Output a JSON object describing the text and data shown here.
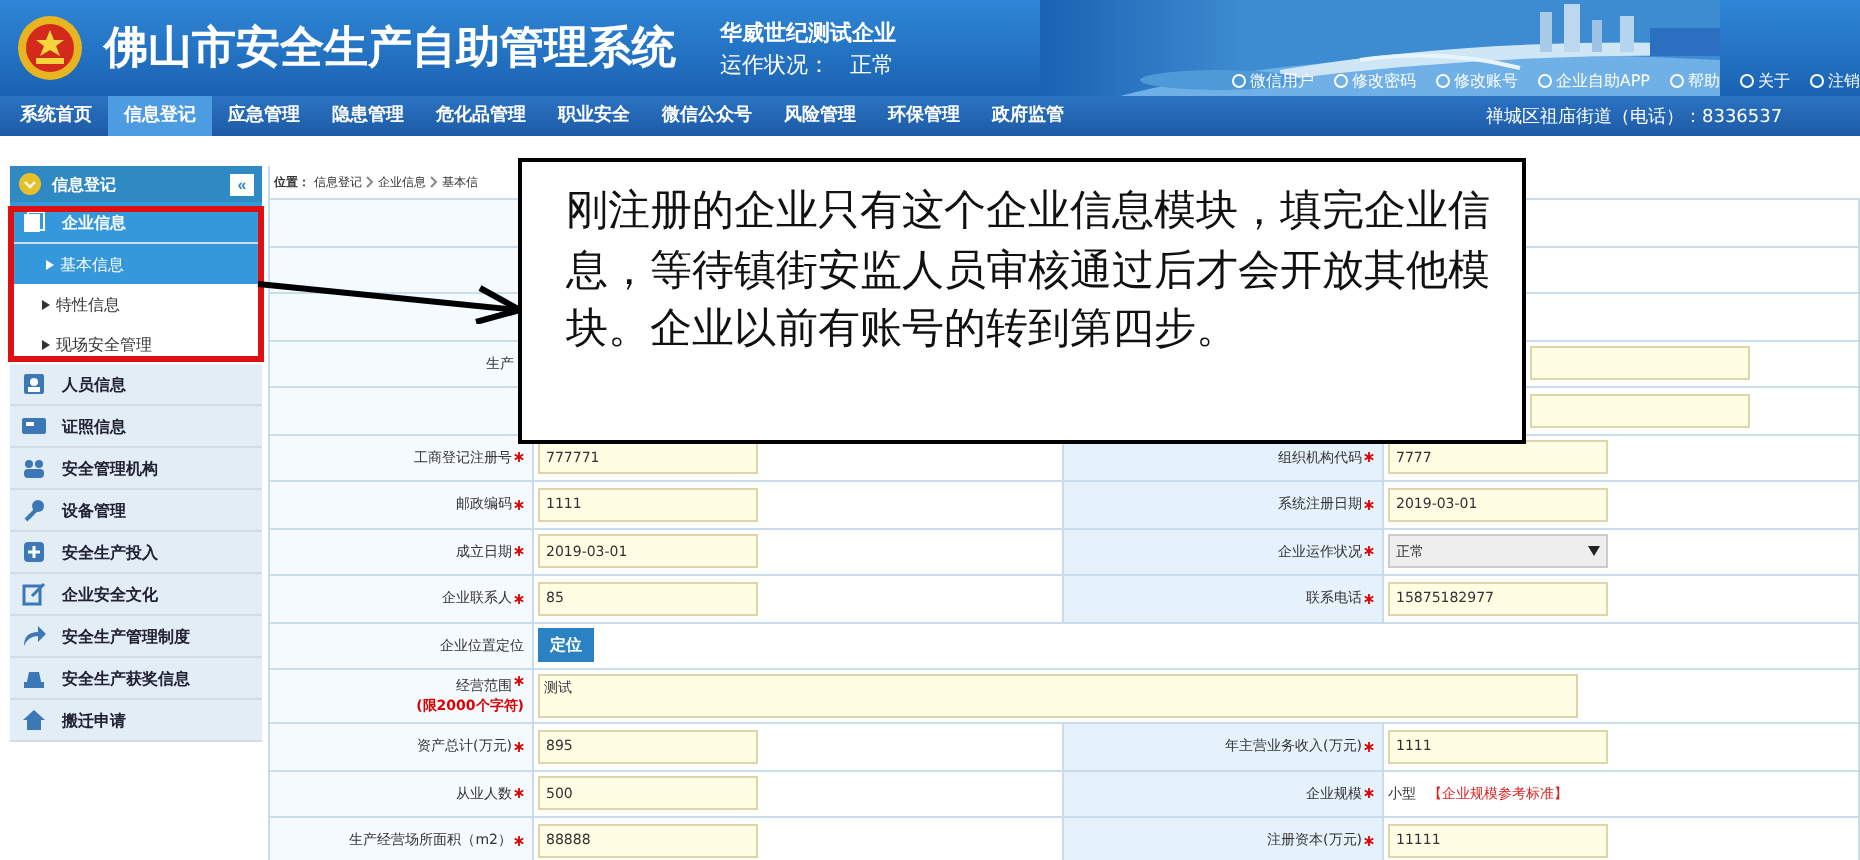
{
  "header": {
    "title": "佛山市安全生产自助管理系统",
    "company": "华威世纪测试企业",
    "status_label": "运作状况：",
    "status_value": "正常",
    "links": [
      "微信用户",
      "修改密码",
      "修改账号",
      "企业自助APP",
      "帮助",
      "关于",
      "注销"
    ]
  },
  "nav": {
    "items": [
      {
        "label": "系统首页",
        "selected": false
      },
      {
        "label": "信息登记",
        "selected": true
      },
      {
        "label": "应急管理",
        "selected": false
      },
      {
        "label": "隐患管理",
        "selected": false
      },
      {
        "label": "危化品管理",
        "selected": false
      },
      {
        "label": "职业安全",
        "selected": false
      },
      {
        "label": "微信公众号",
        "selected": false
      },
      {
        "label": "风险管理",
        "selected": false
      },
      {
        "label": "环保管理",
        "selected": false
      },
      {
        "label": "政府监管",
        "selected": false
      }
    ],
    "contact": "禅城区祖庙街道（电话）：8336537"
  },
  "sidebar": {
    "title": "信息登记",
    "collapse": "«",
    "items": [
      {
        "label": "企业信息",
        "expanded": true,
        "children": [
          {
            "label": "基本信息",
            "selected": true
          },
          {
            "label": "特性信息",
            "selected": false
          },
          {
            "label": "现场安全管理",
            "selected": false
          }
        ]
      },
      {
        "label": "人员信息",
        "expanded": false
      },
      {
        "label": "证照信息",
        "expanded": false
      },
      {
        "label": "安全管理机构",
        "expanded": false
      },
      {
        "label": "设备管理",
        "expanded": false
      },
      {
        "label": "安全生产投入",
        "expanded": false
      },
      {
        "label": "企业安全文化",
        "expanded": false
      },
      {
        "label": "安全生产管理制度",
        "expanded": false
      },
      {
        "label": "安全生产获奖信息",
        "expanded": false
      },
      {
        "label": "搬迁申请",
        "expanded": false
      }
    ]
  },
  "breadcrumb": {
    "label": "位置：",
    "path": [
      "信息登记",
      "企业信息",
      "基本信"
    ]
  },
  "form": {
    "rows": [
      {
        "kind": "hidden"
      },
      {
        "kind": "hidden"
      },
      {
        "kind": "hidden"
      },
      {
        "kind": "hidden",
        "label": "生产",
        "field": true
      },
      {
        "kind": "hidden",
        "field": true
      },
      {
        "kind": "pair",
        "left": {
          "label": "工商登记注册号",
          "required": true,
          "value": "777771"
        },
        "right": {
          "label": "组织机构代码",
          "required": true,
          "value": "7777"
        }
      },
      {
        "kind": "pair",
        "left": {
          "label": "邮政编码",
          "required": true,
          "value": "1111"
        },
        "right": {
          "label": "系统注册日期",
          "required": true,
          "value": "2019-03-01"
        }
      },
      {
        "kind": "pair",
        "left": {
          "label": "成立日期",
          "required": true,
          "value": "2019-03-01"
        },
        "right": {
          "label": "企业运作状况",
          "required": true,
          "value": "正常",
          "kind": "select"
        }
      },
      {
        "kind": "pair",
        "left": {
          "label": "企业联系人",
          "required": true,
          "value": "85"
        },
        "right": {
          "label": "联系电话",
          "required": true,
          "value": "15875182977"
        }
      },
      {
        "kind": "button",
        "label": "企业位置定位",
        "button": "定位"
      },
      {
        "kind": "textarea",
        "label": "经营范围",
        "required": true,
        "note": "(限2000个字符)",
        "value": "测试"
      },
      {
        "kind": "pair",
        "left": {
          "label": "资产总计(万元)",
          "required": true,
          "value": "895"
        },
        "right": {
          "label": "年主营业务收入(万元)",
          "required": true,
          "value": "1111"
        }
      },
      {
        "kind": "pair",
        "left": {
          "label": "从业人数",
          "required": true,
          "value": "500"
        },
        "right": {
          "label": "企业规模",
          "required": true,
          "text": "小型",
          "link": "【企业规模参考标准】"
        }
      },
      {
        "kind": "pair",
        "left": {
          "label": "生产经营场所面积（m2）",
          "required": true,
          "value": "88888"
        },
        "right": {
          "label": "注册资本(万元)",
          "required": true,
          "value": "11111"
        }
      }
    ]
  },
  "callout": {
    "text": "刚注册的企业只有这个企业信息模块，填完企业信息，等待镇街安监人员审核通过后才会开放其他模块。企业以前有账号的转到第四步。"
  }
}
